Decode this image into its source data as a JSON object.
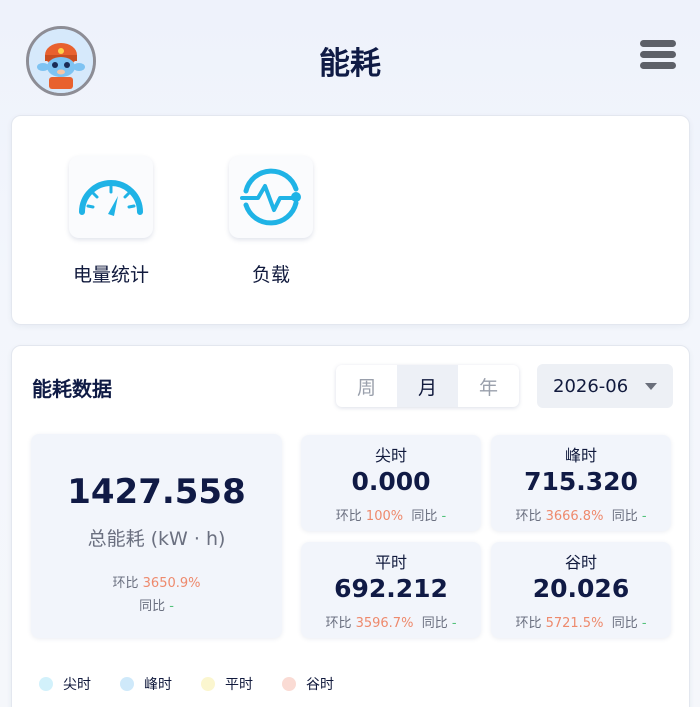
{
  "header": {
    "title": "能耗"
  },
  "nav": [
    {
      "label": "电量统计",
      "icon": "speedometer-icon"
    },
    {
      "label": "负载",
      "icon": "pulse-icon"
    }
  ],
  "energy": {
    "title": "能耗数据",
    "periods": [
      "周",
      "月",
      "年"
    ],
    "selected_period": "月",
    "date": "2026-06",
    "total": {
      "value": "1427.558",
      "label": "总能耗 (kW · h)",
      "ring_label": "环比",
      "ring_value": "3650.9%",
      "yoy_label": "同比",
      "yoy_value": "-"
    },
    "items": [
      {
        "title": "尖时",
        "value": "0.000",
        "ring_label": "环比",
        "ring_value": "100%",
        "yoy_label": "同比",
        "yoy_value": "-"
      },
      {
        "title": "峰时",
        "value": "715.320",
        "ring_label": "环比",
        "ring_value": "3666.8%",
        "yoy_label": "同比",
        "yoy_value": "-"
      },
      {
        "title": "平时",
        "value": "692.212",
        "ring_label": "环比",
        "ring_value": "3596.7%",
        "yoy_label": "同比",
        "yoy_value": "-"
      },
      {
        "title": "谷时",
        "value": "20.026",
        "ring_label": "环比",
        "ring_value": "5721.5%",
        "yoy_label": "同比",
        "yoy_value": "-"
      }
    ],
    "legend": [
      {
        "label": "尖时",
        "color": "#d2f1fb"
      },
      {
        "label": "峰时",
        "color": "#cfe9fa"
      },
      {
        "label": "平时",
        "color": "#fbf6cf"
      },
      {
        "label": "谷时",
        "color": "#fadbd4"
      }
    ]
  },
  "colors": {
    "accent": "#1fb3e6",
    "highlight": "#ee8a6d",
    "neutral_dash": "#52c27a",
    "title": "#0f1b45"
  }
}
